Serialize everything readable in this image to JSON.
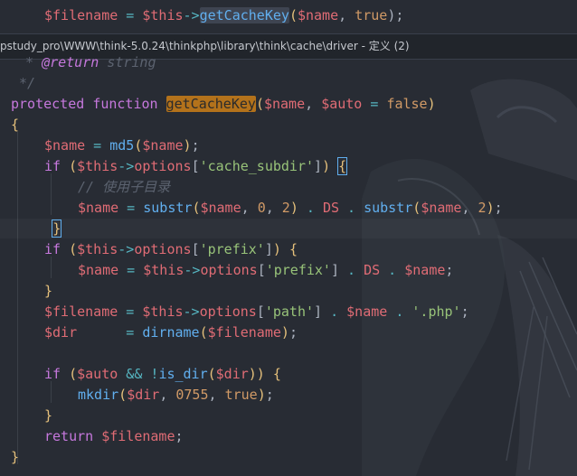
{
  "breadcrumb": {
    "path": "pstudy_pro\\WWW\\think-5.0.24\\thinkphp\\library\\think\\cache\\driver - 定义 (2)"
  },
  "code": {
    "line_top": {
      "var": "$filename",
      "eq": " = ",
      "this": "$this",
      "arrow": "->",
      "call": "getCacheKey",
      "args_open": "(",
      "arg1": "$name",
      "comma": ", ",
      "arg2": "true",
      "args_close": ");"
    },
    "doc_return": {
      "star": "* ",
      "tag": "@return",
      "type": " string"
    },
    "doc_end": "*/",
    "decl": {
      "kw1": "protected",
      "kw2": "function",
      "name": "getCacheKey",
      "p1": "$name",
      "p2": "$auto",
      "def": "false"
    },
    "comment": "// 使用子目录",
    "cache_subdir": "'cache_subdir'",
    "prefix": "'prefix'",
    "path": "'path'",
    "ext": "'.php'",
    "ds": "DS",
    "zero": "0",
    "two": "2",
    "mode": "0755",
    "true_kw": "true",
    "md5": "md5",
    "substr": "substr",
    "dirname": "dirname",
    "is_dir": "is_dir",
    "mkdir": "mkdir",
    "return_kw": "return",
    "if_kw": "if",
    "options": "options",
    "v_name": "$name",
    "v_this": "$this",
    "v_filename": "$filename",
    "v_dir": "$dir",
    "v_auto": "$auto"
  }
}
